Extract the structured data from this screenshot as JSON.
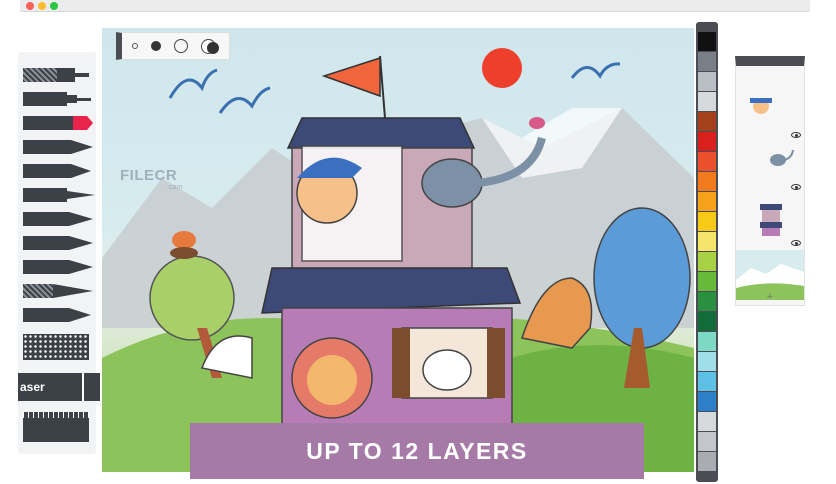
{
  "window": {
    "traffic_lights": [
      "close",
      "minimize",
      "zoom"
    ]
  },
  "brush_sizes": [
    "brush-size-xs",
    "brush-size-s",
    "brush-size-m",
    "brush-size-l"
  ],
  "tools": [
    "fineliner",
    "technical-pen",
    "marker",
    "pencil",
    "crayon",
    "round-brush",
    "flat-brush",
    "airbrush",
    "watercolor-brush",
    "palette-knife",
    "ink-pen",
    "texture-brush",
    "eraser",
    "ruler"
  ],
  "eraser_label": "aser",
  "palette": {
    "colors": [
      "#111111",
      "#7a7f87",
      "#b9bec4",
      "#d7dadd",
      "#a2411c",
      "#d8201d",
      "#e9502b",
      "#f07a1c",
      "#f6a21a",
      "#f9c918",
      "#f6e56b",
      "#a8d145",
      "#67b93a",
      "#2a8f3e",
      "#136b39",
      "#7ed9c4",
      "#9fdfe8",
      "#5fc0e5",
      "#2d7fc9",
      "#d7dadd",
      "#c3c7cb",
      "#a9adb2"
    ]
  },
  "layers": {
    "items": [
      "layer-1",
      "layer-2",
      "layer-3",
      "layer-4"
    ],
    "add_label": "+"
  },
  "watermark": {
    "text": "FILECR",
    "sub": ".com"
  },
  "caption": {
    "text": "UP TO 12 LAYERS",
    "color": "#a57aa7"
  }
}
